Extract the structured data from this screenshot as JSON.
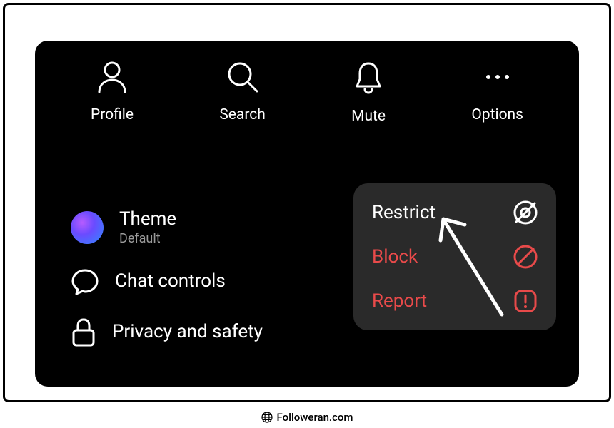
{
  "top_actions": {
    "profile": "Profile",
    "search": "Search",
    "mute": "Mute",
    "options": "Options"
  },
  "settings": {
    "theme_title": "Theme",
    "theme_subtitle": "Default",
    "chat_controls": "Chat controls",
    "privacy": "Privacy and safety"
  },
  "popup": {
    "restrict": "Restrict",
    "block": "Block",
    "report": "Report"
  },
  "watermark": "Followeran.com",
  "colors": {
    "danger": "#e84a4a",
    "popup_bg": "#2a2a2a"
  }
}
